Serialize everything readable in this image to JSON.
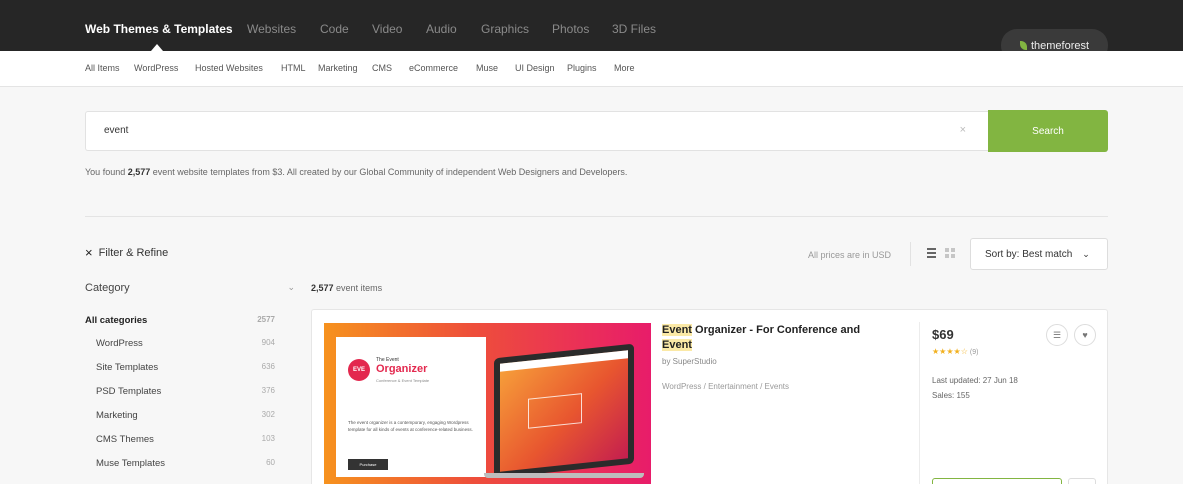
{
  "topnav": {
    "categories": [
      "Web Themes & Templates",
      "Websites",
      "Code",
      "Video",
      "Audio",
      "Graphics",
      "Photos",
      "3D Files"
    ],
    "brand": "themeforest"
  },
  "subnav": {
    "items": [
      "All Items",
      "WordPress",
      "Hosted Websites",
      "HTML",
      "Marketing",
      "CMS",
      "eCommerce",
      "Muse",
      "UI Design",
      "Plugins",
      "More"
    ]
  },
  "search": {
    "value": "event",
    "clear": "×",
    "button": "Search"
  },
  "found": {
    "prefix": "You found",
    "count": "2,577",
    "suffix": "event website templates from $3. All created by our Global Community of independent Web Designers and Developers."
  },
  "toolbar": {
    "filter_label": "Filter & Refine",
    "filter_icon": "×",
    "prices_label": "All prices are in USD",
    "sort_label": "Sort by: Best match",
    "sort_chevron": "⌄"
  },
  "sidebar": {
    "heading": "Category",
    "chevron": "⌄",
    "categories": [
      {
        "label": "All categories",
        "count": "2577"
      },
      {
        "label": "WordPress",
        "count": "904"
      },
      {
        "label": "Site Templates",
        "count": "636"
      },
      {
        "label": "PSD Templates",
        "count": "376"
      },
      {
        "label": "Marketing",
        "count": "302"
      },
      {
        "label": "CMS Themes",
        "count": "103"
      },
      {
        "label": "Muse Templates",
        "count": "60"
      }
    ]
  },
  "results": {
    "count": "2,577",
    "label": "event items"
  },
  "product": {
    "title_highlight": "Event",
    "title_mid": " Organizer - For Conference and ",
    "title_highlight2": "Event",
    "author": "by SuperStudio",
    "crumbs": "WordPress / Entertainment / Events",
    "price": "$69",
    "stars": "★★★★☆",
    "rating_count": "(9)",
    "updated": "Last updated: 27 Jun 18",
    "sales": "Sales: 155",
    "thumb": {
      "logo": "EVE",
      "the": "The Event",
      "organizer": "Organizer",
      "tagline": "Conference & Event Template",
      "description": "The event organizer is a contemporary, engaging Wordpress template for all kinds of events at conference-related business.",
      "button": "Purchase"
    }
  },
  "colors": {
    "accent": "#82b541",
    "nav_bg": "#262626",
    "highlight": "#fbe9a6",
    "star": "#f2b01e"
  }
}
